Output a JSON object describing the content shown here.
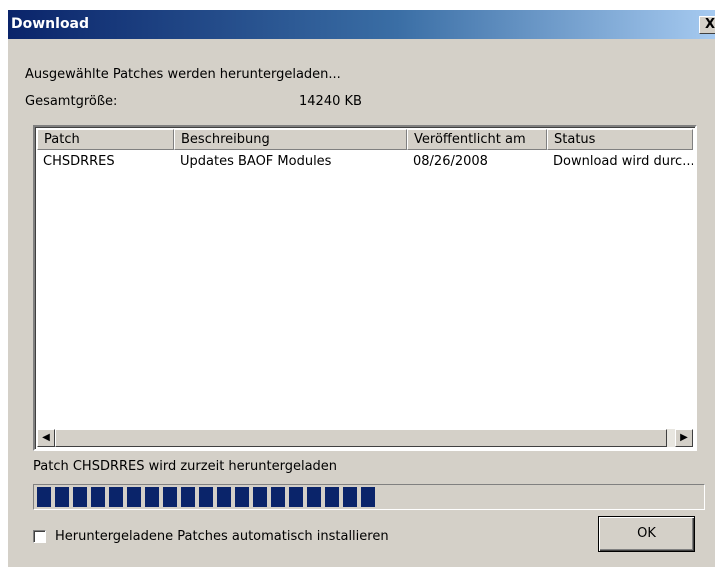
{
  "window": {
    "title": "Download",
    "close_label": "X"
  },
  "message": "Ausgewählte Patches werden heruntergeladen...",
  "total_size": {
    "label": "Gesamtgröße:",
    "value": "14240 KB"
  },
  "table": {
    "columns": [
      "Patch",
      "Beschreibung",
      "Veröffentlicht am",
      "Status"
    ],
    "rows": [
      [
        "CHSDRRES",
        "Updates BAOF Modules",
        "08/26/2008",
        "Download wird durc..."
      ]
    ]
  },
  "scrollbar": {
    "left_arrow": "◀",
    "right_arrow": "▶"
  },
  "status_text": "Patch CHSDRRES wird zurzeit heruntergeladen",
  "progress": {
    "percent": 51
  },
  "auto_install": {
    "label": "Heruntergeladene Patches automatisch installieren",
    "checked": false
  },
  "ok_button": "OK"
}
